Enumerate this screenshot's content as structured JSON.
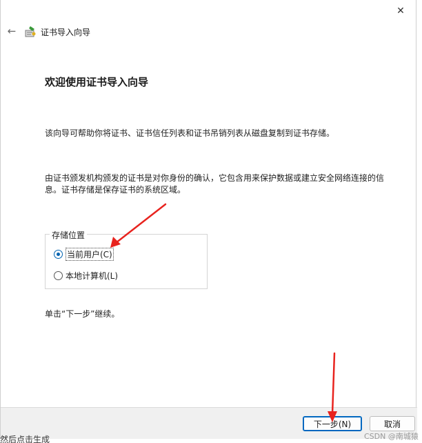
{
  "window": {
    "close_glyph": "✕",
    "back_glyph": "←",
    "title": "证书导入向导"
  },
  "main": {
    "heading": "欢迎使用证书导入向导",
    "para1": "该向导可帮助你将证书、证书信任列表和证书吊销列表从磁盘复制到证书存储。",
    "para2": "由证书颁发机构颁发的证书是对你身份的确认，它包含用来保护数据或建立安全网络连接的信息。证书存储是保存证书的系统区域。",
    "store_group": {
      "legend": "存储位置",
      "options": [
        {
          "label": "当前用户(C)",
          "checked": true
        },
        {
          "label": "本地计算机(L)",
          "checked": false
        }
      ]
    },
    "continue_text": "单击“下一步”继续。"
  },
  "footer": {
    "next_label": "下一步(N)",
    "cancel_label": "取消"
  },
  "background": {
    "below_text": "然后点击生成",
    "watermark": "CSDN @南城猿"
  },
  "colors": {
    "accent": "#0063b1",
    "annotation_arrow": "#e8231e"
  }
}
